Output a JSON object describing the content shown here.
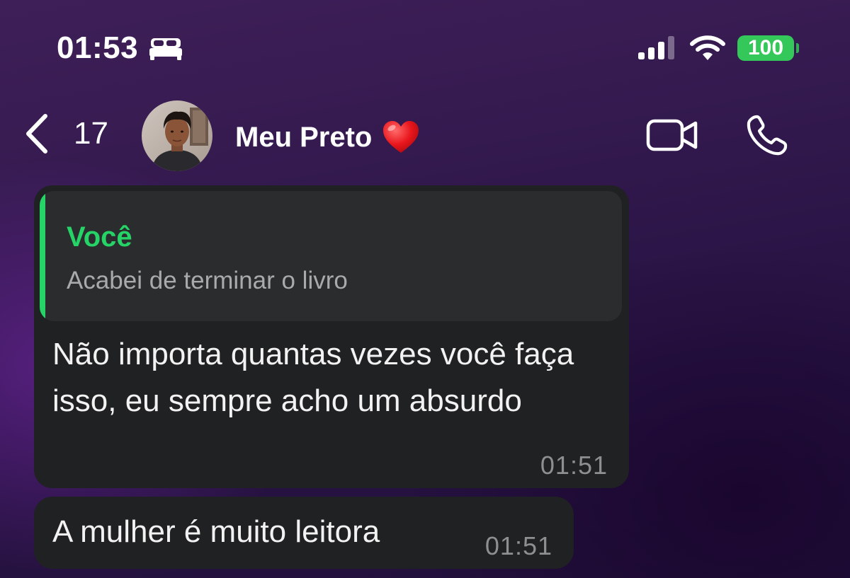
{
  "status_bar": {
    "time": "01:53",
    "focus_icon": "bed-icon",
    "signal_icon": "cellular-signal-icon",
    "wifi_icon": "wifi-icon",
    "battery_level": "100",
    "battery_color": "#34c759"
  },
  "header": {
    "back_icon": "chevron-left-icon",
    "back_count": "17",
    "contact_name": "Meu Preto",
    "contact_emoji": "heart-icon",
    "actions": [
      "video-camera-icon",
      "phone-icon"
    ]
  },
  "messages": [
    {
      "quote": {
        "author": "Você",
        "text": "Acabei de terminar o livro"
      },
      "text": "Não importa quantas vezes você faça isso, eu sempre acho um absurdo",
      "time": "01:51"
    },
    {
      "text": "A mulher é muito leitora",
      "time": "01:51"
    }
  ],
  "colors": {
    "accent_green": "#25d366",
    "bubble_bg": "#202122",
    "quote_bg": "#2b2c2e",
    "timestamp": "#8e8f91"
  }
}
